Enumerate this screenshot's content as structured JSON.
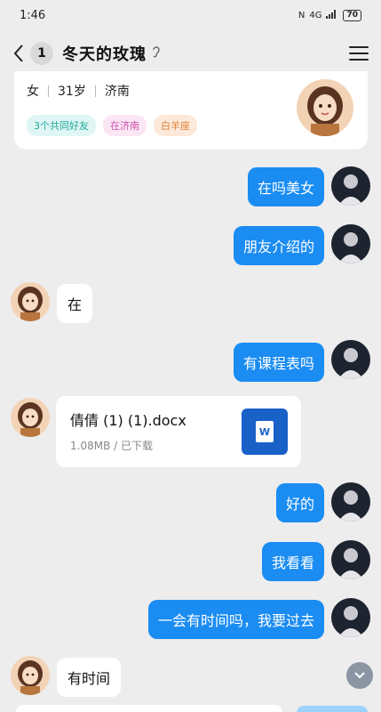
{
  "status_bar": {
    "time": "1:46",
    "network": "4G",
    "battery": "70"
  },
  "header": {
    "unread_count": "1",
    "title": "冬天的玫瑰"
  },
  "profile": {
    "gender": "女",
    "age": "31岁",
    "city": "济南",
    "tags": [
      "3个共同好友",
      "在济南",
      "白羊座"
    ]
  },
  "messages": [
    {
      "side": "out",
      "text": "在吗美女"
    },
    {
      "side": "out",
      "text": "朋友介绍的"
    },
    {
      "side": "in",
      "text": "在"
    },
    {
      "side": "out",
      "text": "有课程表吗"
    },
    {
      "side": "in",
      "type": "file",
      "file_name": "倩倩 (1) (1).docx",
      "file_meta": "1.08MB / 已下载",
      "file_icon_letter": "W"
    },
    {
      "side": "out",
      "text": "好的"
    },
    {
      "side": "out",
      "text": "我看看"
    },
    {
      "side": "out",
      "text": "一会有时间吗，我要过去"
    },
    {
      "side": "in",
      "text": "有时间"
    }
  ],
  "colors": {
    "bubble_out": "#1a8cf2",
    "bubble_in": "#ffffff",
    "background": "#ededed",
    "word_blue": "#1861c7"
  }
}
